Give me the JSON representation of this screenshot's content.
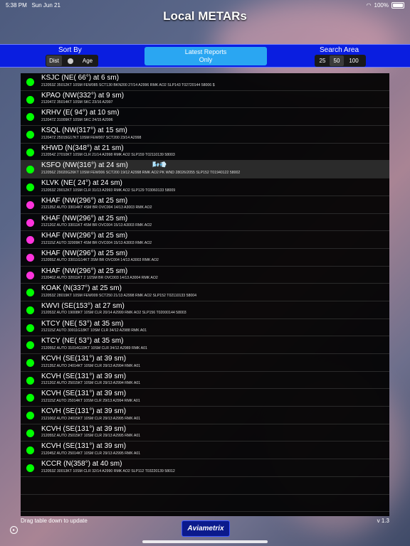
{
  "statusbar": {
    "time": "5:38 PM",
    "date": "Sun Jun 21",
    "battery": "100%"
  },
  "app": {
    "title": "Local METARs"
  },
  "sort": {
    "label": "Sort By",
    "options": [
      "Dist",
      " ",
      "Age"
    ],
    "selected": "Dist"
  },
  "latest": {
    "line1": "Latest Reports",
    "line2": "Only"
  },
  "search": {
    "label": "Search Area",
    "options": [
      "25",
      "50",
      "100"
    ],
    "selected": "50"
  },
  "colors": {
    "green": "#00ff00",
    "magenta": "#ff33dd",
    "accent": "#0a1ee0",
    "button": "#2aa6f2"
  },
  "reports": [
    {
      "head": "KSJC  (NE( 66°) at   6 sm)",
      "raw": "212053Z 35012KT 10SM FEW085 SCT130 BKN200 27/14 A2996 RMK AO2 SLP143 T02720144 58006 $",
      "dot": "green"
    },
    {
      "head": "KPAO  (NW(332°) at   9 sm)",
      "raw": "212047Z 35014KT 10SM SKC 23/16 A2997",
      "dot": "green"
    },
    {
      "head": "KRHV  (E( 94°) at  10 sm)",
      "raw": "212047Z 31009KT 10SM SKC 24/15 A2996",
      "dot": "green"
    },
    {
      "head": "KSQL  (NW(317°) at  15 sm)",
      "raw": "212047Z 25015G17KT 10SM FEW007 SCT200 23/14 A2998",
      "dot": "green"
    },
    {
      "head": "KHWD  (N(348°) at  21 sm)",
      "raw": "212054Z 27010KT 10SM CLR 21/14 A2998 RMK AO2 SLP159 T02110139 58003",
      "dot": "green"
    },
    {
      "head": "KSFO  (NW(316°) at  24 sm)",
      "raw": "212056Z 29020G26KT 10SM FEW006 SCT200 19/12 A2998 RMK AO2 PK WND 28026/2055 SLP152 T01940122 58002",
      "dot": "green",
      "extra": "🌬️💨"
    },
    {
      "head": "KLVK  (NE( 24°) at  24 sm)",
      "raw": "212053Z 29012KT 10SM CLR 31/13 A2993 RMK AO2 SLP129 T03060133 58009",
      "dot": "green"
    },
    {
      "head": "KHAF  (NW(296°) at  25 sm)",
      "raw": "212135Z AUTO 33014KT 4SM BR OVC004 14/13 A3003 RMK AO2",
      "dot": "magenta"
    },
    {
      "head": "KHAF  (NW(296°) at  25 sm)",
      "raw": "212120Z AUTO 33011KT 4SM BR OVC004 15/13 A3003 RMK AO2",
      "dot": "magenta"
    },
    {
      "head": "KHAF  (NW(296°) at  25 sm)",
      "raw": "212115Z AUTO 32009KT 4SM BR OVC004 15/13 A3003 RMK AO2",
      "dot": "magenta"
    },
    {
      "head": "KHAF  (NW(296°) at  25 sm)",
      "raw": "212055Z AUTO 33011G14KT 3SM BR OVC004 14/13 A3003 RMK AO2",
      "dot": "magenta"
    },
    {
      "head": "KHAF  (NW(296°) at  25 sm)",
      "raw": "212040Z AUTO 32011KT 2 1/2SM BR OVC003 14/13 A3004 RMK AO2",
      "dot": "magenta"
    },
    {
      "head": "KOAK  (N(337°) at  25 sm)",
      "raw": "212053Z 28019KT 10SM FEW009 SCT250 21/13 A2998 RMK AO2 SLP152 T02110133 58004",
      "dot": "green"
    },
    {
      "head": "KWVI  (SE(153°) at  27 sm)",
      "raw": "212053Z AUTO 19008KT 10SM CLR 20/14 A2999 RMK AO2 SLP156 T02000144 58003",
      "dot": "green"
    },
    {
      "head": "KTCY  (NE( 53°) at  35 sm)",
      "raw": "212115Z AUTO 30011G18KT 10SM CLR 34/12 A2988 RMK A01",
      "dot": "green"
    },
    {
      "head": "KTCY  (NE( 53°) at  35 sm)",
      "raw": "212055Z AUTO 31014G19KT 10SM CLR 34/12 A2989 RMK A01",
      "dot": "green"
    },
    {
      "head": "KCVH  (SE(131°) at  39 sm)",
      "raw": "212135Z AUTO 24014KT 10SM CLR 29/13 A2994 RMK A01",
      "dot": "green"
    },
    {
      "head": "KCVH  (SE(131°) at  39 sm)",
      "raw": "212120Z AUTO 25015KT 10SM CLR 29/13 A2994 RMK A01",
      "dot": "green"
    },
    {
      "head": "KCVH  (SE(131°) at  39 sm)",
      "raw": "212115Z AUTO 25014KT 10SM CLR 29/13 A2994 RMK A01",
      "dot": "green"
    },
    {
      "head": "KCVH  (SE(131°) at  39 sm)",
      "raw": "212100Z AUTO 24015KT 10SM CLR 29/13 A2995 RMK A01",
      "dot": "green"
    },
    {
      "head": "KCVH  (SE(131°) at  39 sm)",
      "raw": "212055Z AUTO 25015KT 10SM CLR 29/13 A2995 RMK A01",
      "dot": "green"
    },
    {
      "head": "KCVH  (SE(131°) at  39 sm)",
      "raw": "212045Z AUTO 25014KT 10SM CLR 29/13 A2995 RMK A01",
      "dot": "green"
    },
    {
      "head": "KCCR  (N(358°) at  40 sm)",
      "raw": "212053Z 30013KT 10SM CLR 32/14 A2990 RMK AO2 SLP112 T03220139 58012",
      "dot": "green"
    }
  ],
  "footer": {
    "hint": "Drag table down to update",
    "version": "v 1.3",
    "logo": "Aviametrix"
  }
}
